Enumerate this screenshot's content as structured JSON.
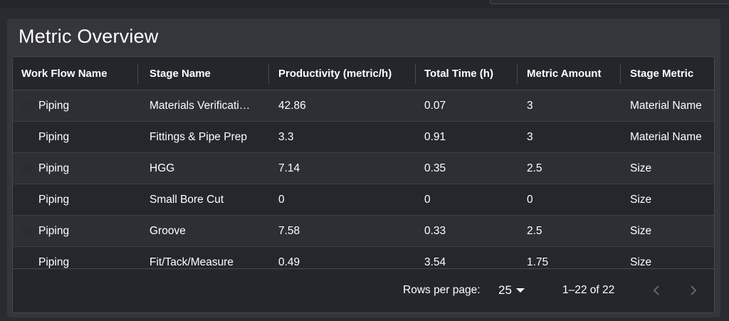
{
  "panel": {
    "title": "Metric Overview"
  },
  "table": {
    "columns": [
      "Work Flow Name",
      "Stage Name",
      "Productivity (metric/h)",
      "Total Time (h)",
      "Metric Amount",
      "Stage Metric"
    ],
    "rows": [
      [
        "Piping",
        "Materials Verificati…",
        "42.86",
        "0.07",
        "3",
        "Material Name"
      ],
      [
        "Piping",
        "Fittings & Pipe Prep",
        "3.3",
        "0.91",
        "3",
        "Material Name"
      ],
      [
        "Piping",
        "HGG",
        "7.14",
        "0.35",
        "2.5",
        "Size"
      ],
      [
        "Piping",
        "Small Bore Cut",
        "0",
        "0",
        "0",
        "Size"
      ],
      [
        "Piping",
        "Groove",
        "7.58",
        "0.33",
        "2.5",
        "Size"
      ],
      [
        "Piping",
        "Fit/Tack/Measure",
        "0.49",
        "3.54",
        "1.75",
        "Size"
      ]
    ]
  },
  "pagination": {
    "rows_per_page_label": "Rows per page:",
    "rows_per_page_value": "25",
    "range_text": "1–22 of 22",
    "prev_icon": "chevron-left-icon",
    "next_icon": "chevron-right-icon"
  },
  "colors": {
    "panel_bg": "#35363c",
    "grid_bg": "#25262b",
    "row_alt_bg": "#2e2f35",
    "text": "#ffffff",
    "icon_disabled": "#6b6c73"
  }
}
